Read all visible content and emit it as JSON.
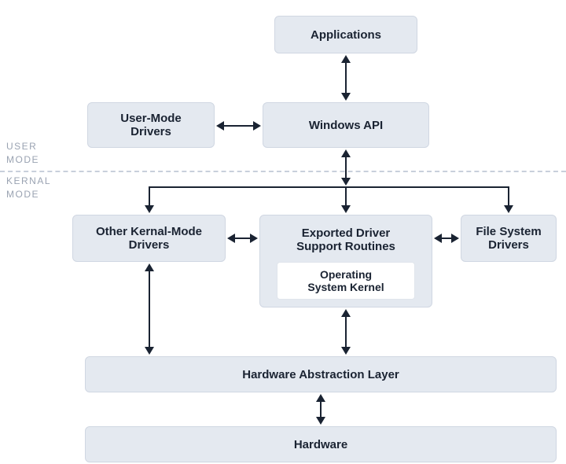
{
  "diagram": {
    "applications": "Applications",
    "userModeDrivers": "User-Mode\nDrivers",
    "windowsApi": "Windows API",
    "otherKernal": "Other Kernal-Mode\nDrivers",
    "exportedRoutines": "Exported Driver\nSupport Routines",
    "osKernel": "Operating\nSystem Kernel",
    "fileSystemDrivers": "File System\nDrivers",
    "hal": "Hardware Abstraction Layer",
    "hardware": "Hardware"
  },
  "labels": {
    "userMode": "USER\nMODE",
    "kernalMode": "KERNAL\nMODE"
  }
}
